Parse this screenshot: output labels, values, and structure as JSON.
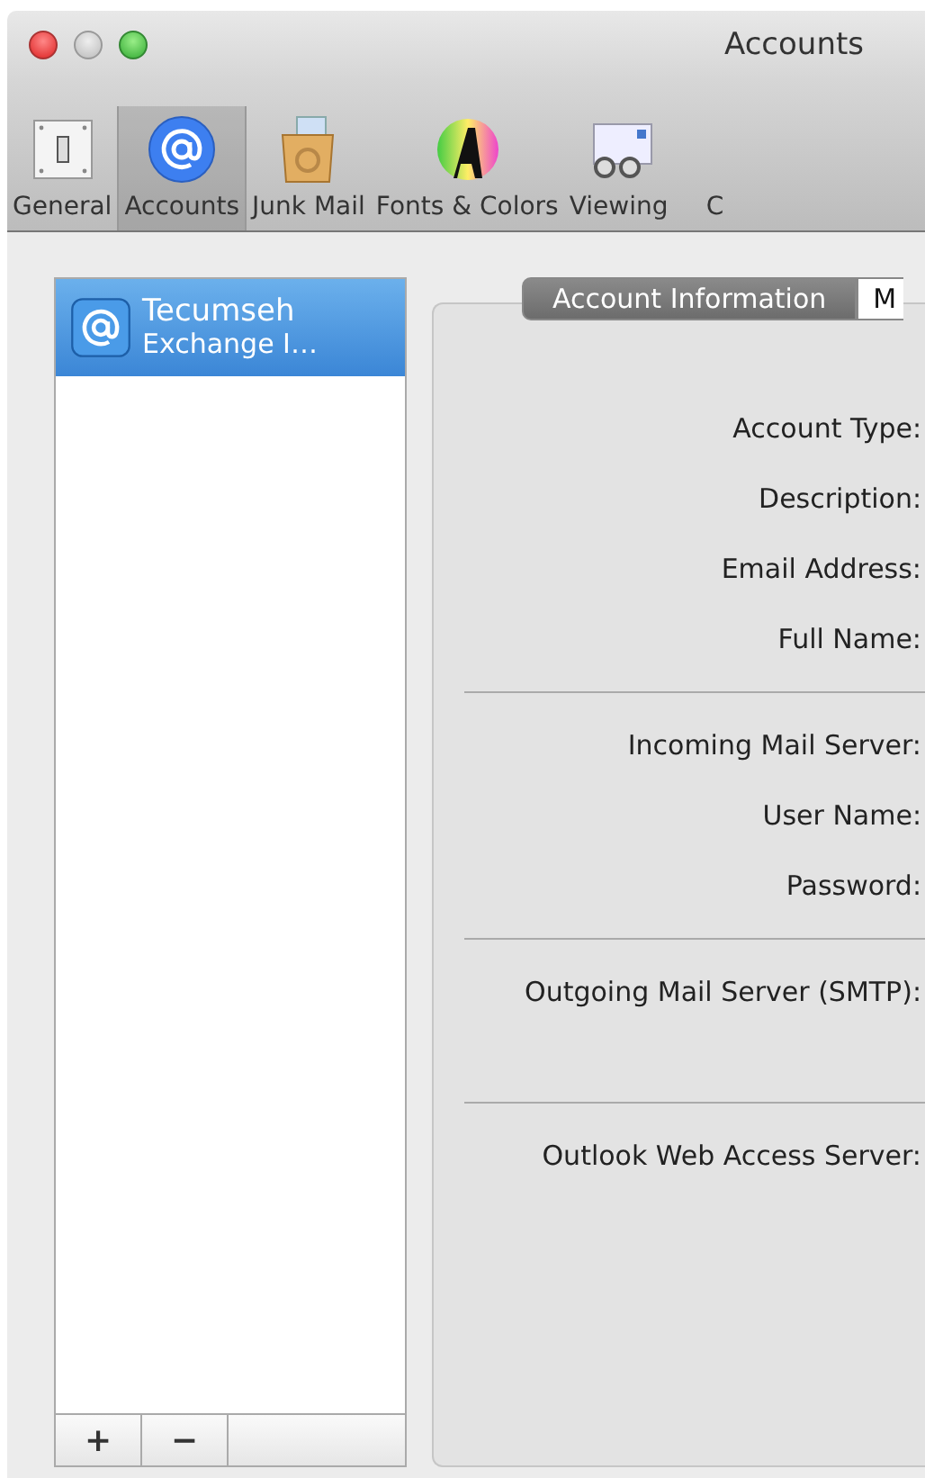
{
  "window": {
    "title": "Accounts"
  },
  "toolbar": [
    {
      "kind": "general",
      "label": "General",
      "selected": false
    },
    {
      "kind": "accounts",
      "label": "Accounts",
      "selected": true
    },
    {
      "kind": "junk",
      "label": "Junk Mail",
      "selected": false
    },
    {
      "kind": "fonts",
      "label": "Fonts & Colors",
      "selected": false
    },
    {
      "kind": "viewing",
      "label": "Viewing",
      "selected": false
    },
    {
      "kind": "cut",
      "label": "C",
      "selected": false
    }
  ],
  "accounts": [
    {
      "name": "Tecumseh",
      "type": "Exchange I…",
      "selected": true
    }
  ],
  "list_buttons": [
    "+",
    "−"
  ],
  "tabs": [
    {
      "label": "Account Information",
      "selected": true
    },
    {
      "label": "M",
      "selected": false
    }
  ],
  "field_groups": [
    [
      "Account Type:",
      "Description:",
      "Email Address:",
      "Full Name:"
    ],
    [
      "Incoming Mail Server:",
      "User Name:",
      "Password:"
    ],
    [
      "Outgoing Mail Server (SMTP):"
    ],
    [
      "Outlook Web Access Server:"
    ]
  ]
}
